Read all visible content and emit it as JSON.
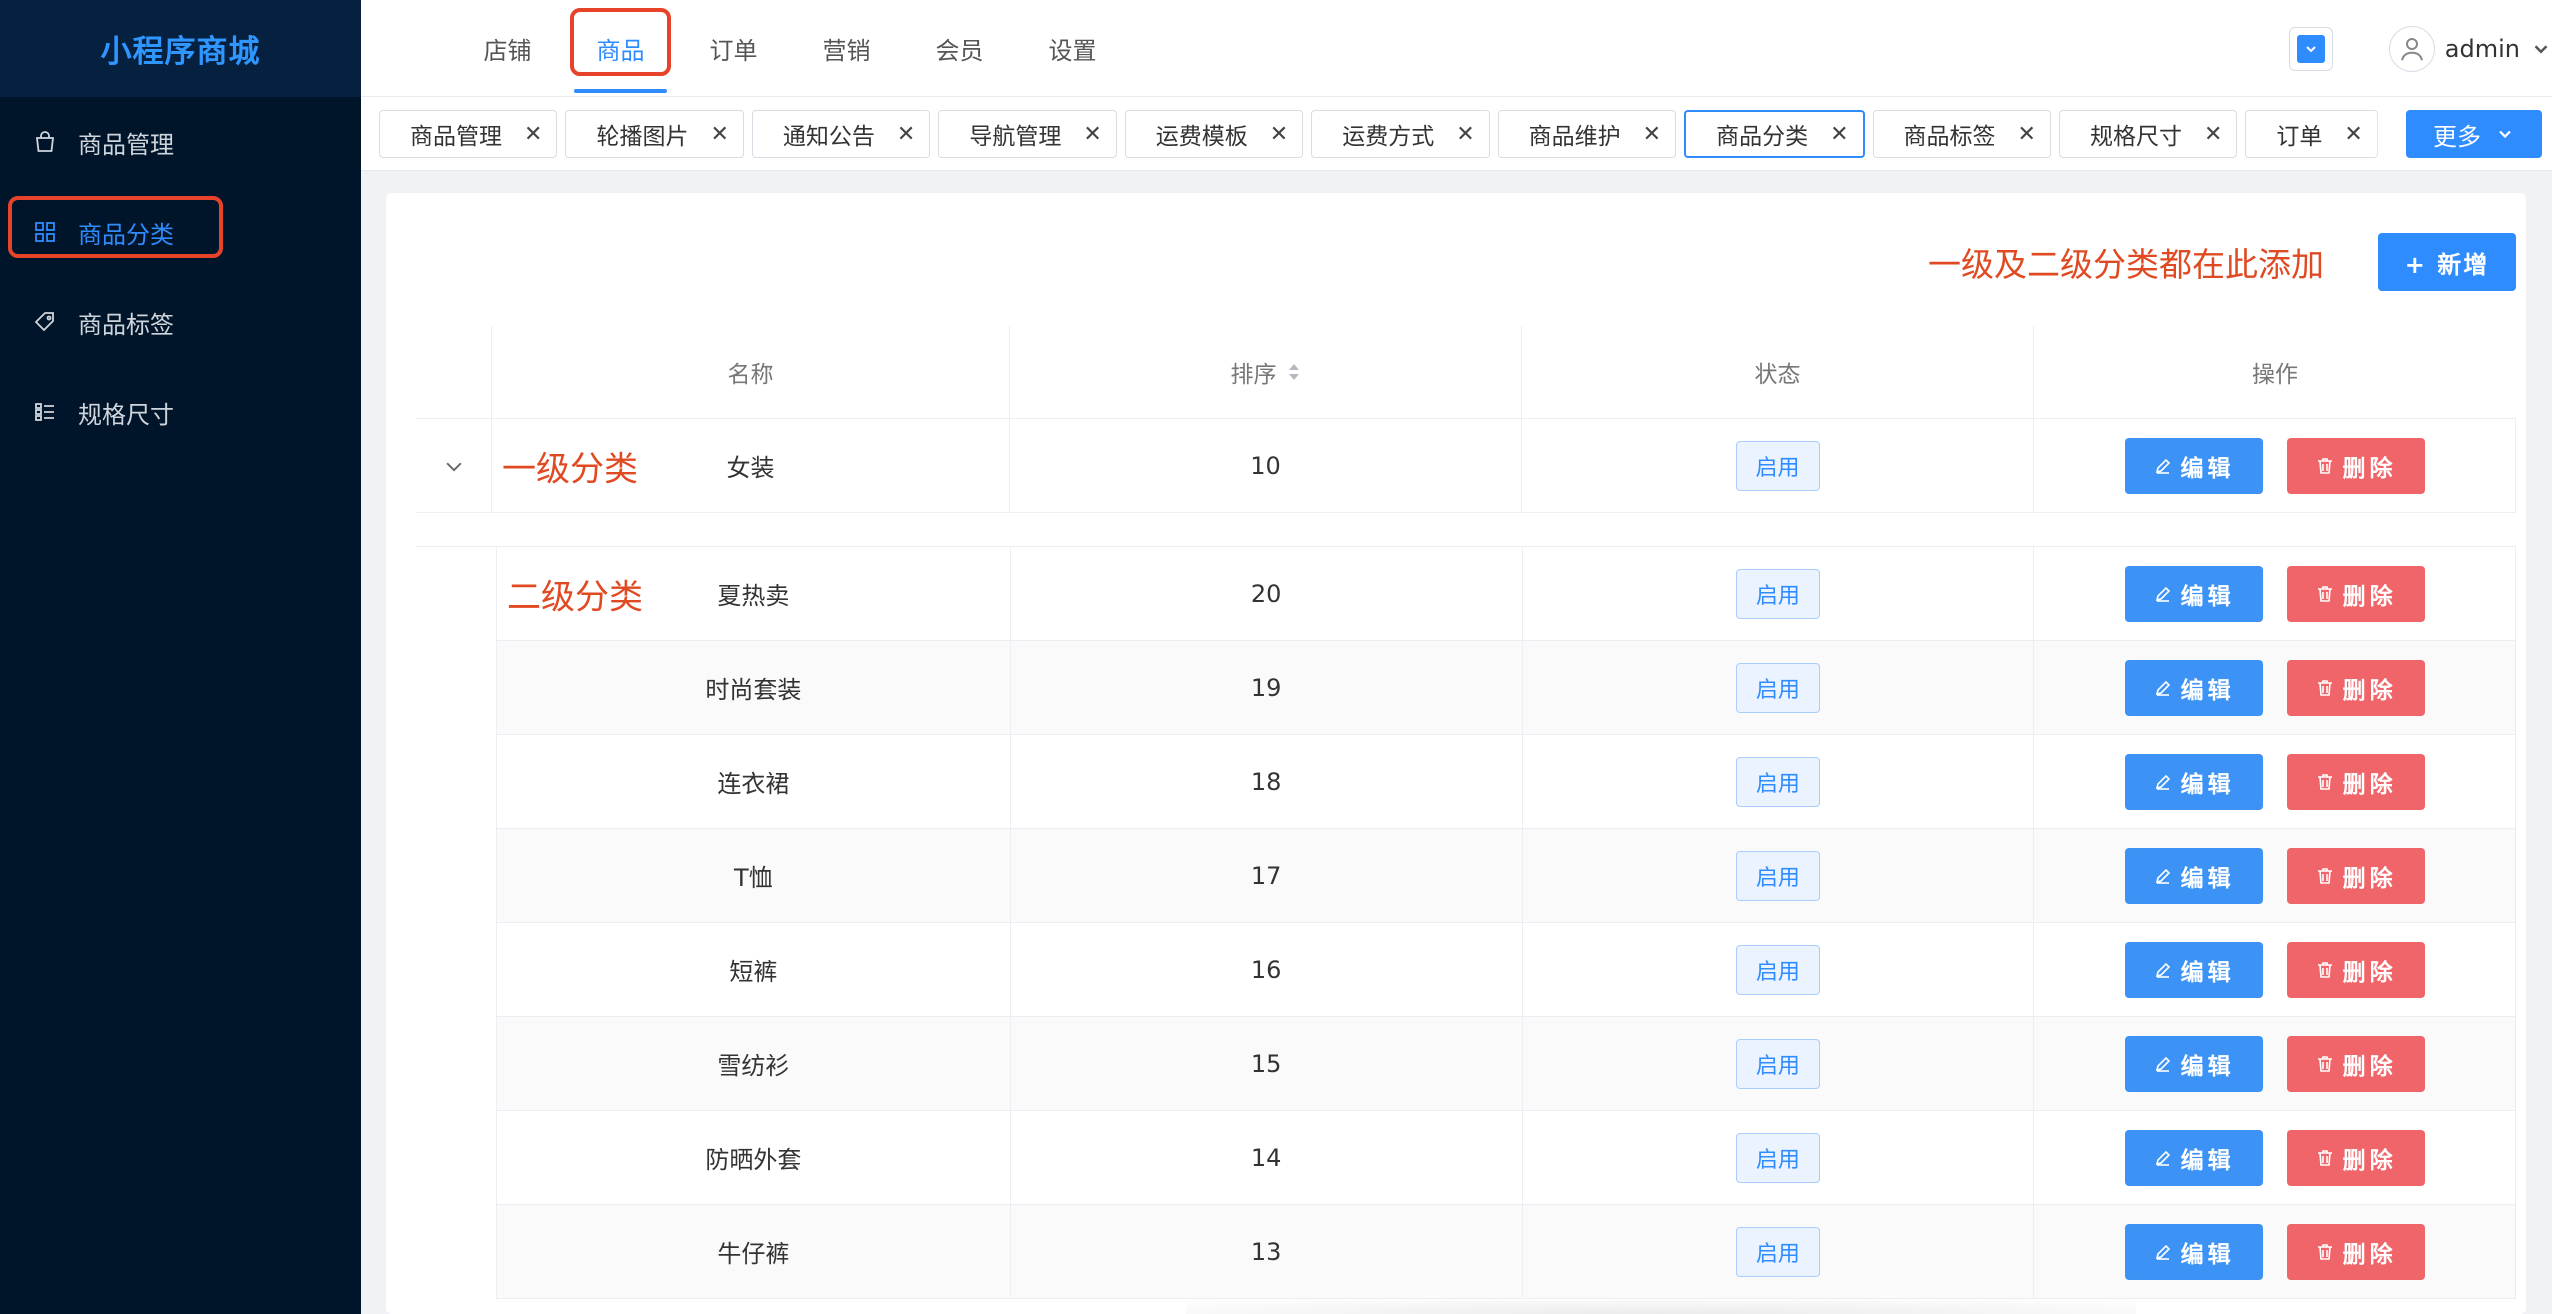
{
  "brand": "小程序商城",
  "sidebar": {
    "items": [
      {
        "label": "商品管理",
        "icon": "bag-icon"
      },
      {
        "label": "商品分类",
        "icon": "grid-icon",
        "active": true
      },
      {
        "label": "商品标签",
        "icon": "tag-icon"
      },
      {
        "label": "规格尺寸",
        "icon": "list-icon"
      }
    ]
  },
  "topnav": {
    "items": [
      "店铺",
      "商品",
      "订单",
      "营销",
      "会员",
      "设置"
    ],
    "active_index": 1
  },
  "user": {
    "name": "admin"
  },
  "tabs": {
    "items": [
      "商品管理",
      "轮播图片",
      "通知公告",
      "导航管理",
      "运费模板",
      "运费方式",
      "商品维护",
      "商品分类",
      "商品标签",
      "规格尺寸",
      "订单"
    ],
    "active": "商品分类",
    "more_label": "更多"
  },
  "content": {
    "hint": "一级及二级分类都在此添加",
    "add_label": "+ 新增"
  },
  "table": {
    "headers": {
      "name": "名称",
      "sort": "排序",
      "status": "状态",
      "ops": "操作"
    },
    "edit_label": "编辑",
    "delete_label": "删除",
    "level1_tag": "一级分类",
    "level2_tag": "二级分类",
    "parent": {
      "name": "女装",
      "sort": "10",
      "status": "启用"
    },
    "children": [
      {
        "name": "夏热卖",
        "sort": "20",
        "status": "启用"
      },
      {
        "name": "时尚套装",
        "sort": "19",
        "status": "启用"
      },
      {
        "name": "连衣裙",
        "sort": "18",
        "status": "启用"
      },
      {
        "name": "T恤",
        "sort": "17",
        "status": "启用"
      },
      {
        "name": "短裤",
        "sort": "16",
        "status": "启用"
      },
      {
        "name": "雪纺衫",
        "sort": "15",
        "status": "启用"
      },
      {
        "name": "防晒外套",
        "sort": "14",
        "status": "启用"
      },
      {
        "name": "牛仔裤",
        "sort": "13",
        "status": "启用"
      }
    ]
  },
  "colors": {
    "primary": "#2f8cff",
    "danger": "#f06569",
    "annotation": "#e04a22",
    "sidebar": "#001529"
  }
}
